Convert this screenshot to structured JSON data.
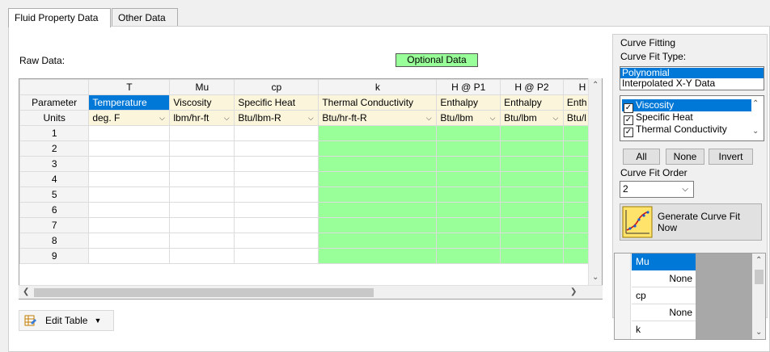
{
  "tabs": [
    "Fluid Property Data",
    "Other Data"
  ],
  "raw_data_label": "Raw Data:",
  "optional_data_label": "Optional Data",
  "grid": {
    "columns": [
      "T",
      "Mu",
      "cp",
      "k",
      "H @ P1",
      "H @ P2",
      "H"
    ],
    "row_headers": [
      "Parameter",
      "Units",
      "1",
      "2",
      "3",
      "4",
      "5",
      "6",
      "7",
      "8",
      "9"
    ],
    "parameters": [
      "Temperature",
      "Viscosity",
      "Specific Heat",
      "Thermal Conductivity",
      "Enthalpy",
      "Enthalpy",
      "Enth"
    ],
    "units": [
      "deg. F",
      "lbm/hr-ft",
      "Btu/lbm-R",
      "Btu/hr-ft-R",
      "Btu/lbm",
      "Btu/lbm",
      "Btu/l"
    ]
  },
  "edit_table_label": "Edit Table",
  "curve_fitting": {
    "group_label": "Curve Fitting",
    "type_label": "Curve Fit Type:",
    "types": [
      "Polynomial",
      "Interpolated X-Y Data"
    ],
    "selected_type": "Polynomial",
    "properties": [
      "Viscosity",
      "Specific Heat",
      "Thermal Conductivity"
    ],
    "buttons": {
      "all": "All",
      "none": "None",
      "invert": "Invert"
    },
    "order_label": "Curve Fit Order",
    "order_value": "2",
    "generate_label": "Generate Curve Fit Now"
  },
  "fit_summary": [
    {
      "label": "Mu",
      "value": "None"
    },
    {
      "label": "cp",
      "value": "None"
    },
    {
      "label": "k",
      "value": ""
    }
  ],
  "colors": {
    "accent": "#0078d7",
    "optional": "#99ff99",
    "param_bg": "#fbf5dc"
  }
}
